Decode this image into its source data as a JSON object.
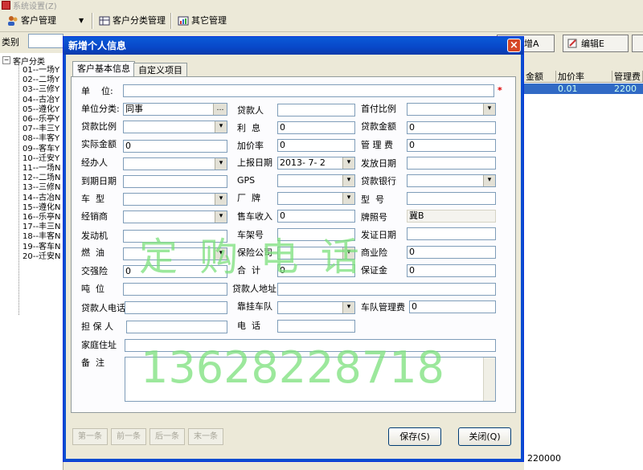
{
  "app": {
    "title": "系统设置(Z)",
    "toolbar": {
      "customer_mgmt": "客户管理",
      "customer_category_mgmt": "客户分类管理",
      "other_mgmt": "其它管理"
    },
    "filter_label": "类别",
    "right_buttons": {
      "add": "新增A",
      "edit": "编辑E"
    },
    "grid_headers": [
      "金额",
      "加价率",
      "管理费"
    ],
    "selected_row": {
      "markup": "0.01",
      "fee": "2200"
    },
    "footer_total": "220000"
  },
  "tree": {
    "root": "客户分类",
    "items": [
      "01--一场Y",
      "02--二场Y",
      "03--三修Y",
      "04--古冶Y",
      "05--遵化Y",
      "06--乐亭Y",
      "07--丰三Y",
      "08--丰客Y",
      "09--客车Y",
      "10--迁安Y",
      "11--一场N",
      "12--二场N",
      "13--三修N",
      "14--古冶N",
      "15--遵化N",
      "16--乐亭N",
      "17--丰三N",
      "18--丰客N",
      "19--客车N",
      "20--迁安N"
    ]
  },
  "dialog": {
    "title": "新增个人信息",
    "tabs": [
      "客户基本信息",
      "自定义项目"
    ],
    "fields": {
      "unit_label": "单    位:",
      "unit_category_label": "单位分类:",
      "unit_category_value": "同事",
      "loan_person_label": "贷款人",
      "down_payment_ratio_label": "首付比例",
      "loan_ratio_label": "贷款比例",
      "interest_label": "利  息",
      "interest_value": "0",
      "loan_amount_label": "贷款金额",
      "loan_amount_value": "0",
      "actual_amount_label": "实际金额",
      "actual_amount_value": "0",
      "markup_rate_label": "加价率",
      "markup_rate_value": "0",
      "mgmt_fee_label": "管 理 费",
      "mgmt_fee_value": "0",
      "handler_label": "经办人",
      "report_date_label": "上报日期",
      "report_date_value": "2013- 7- 2",
      "issue_date_label": "发放日期",
      "due_date_label": "到期日期",
      "gps_label": "GPS",
      "loan_bank_label": "贷款银行",
      "car_type_label": "车  型",
      "brand_label": "厂  牌",
      "model_label": "型  号",
      "dealer_label": "经销商",
      "car_sale_income_label": "售车收入",
      "car_sale_income_value": "0",
      "plate_no_label": "牌照号",
      "plate_no_value": "冀B",
      "engine_label": "发动机",
      "frame_no_label": "车架号",
      "cert_date_label": "发证日期",
      "fuel_label": "燃  油",
      "insurance_co_label": "保险公司",
      "commercial_ins_label": "商业险",
      "commercial_ins_value": "0",
      "compulsory_ins_label": "交强险",
      "compulsory_ins_value": "0",
      "total_label": "合  计",
      "total_value": "0",
      "deposit_label": "保证金",
      "deposit_value": "0",
      "tonnage_label": "吨  位",
      "loan_person_addr_label": "贷款人地址",
      "loan_person_phone_label": "贷款人电话",
      "fleet_label": "靠挂车队",
      "fleet_mgmt_fee_label": "车队管理费",
      "fleet_mgmt_fee_value": "0",
      "guarantor_label": "担 保 人",
      "phone_label": "电  话",
      "home_addr_label": "家庭住址",
      "remark_label": "备  注"
    },
    "watermark": {
      "text1": "定 购 电 话",
      "text2": "13628228718"
    },
    "nav": [
      "第一条",
      "前一条",
      "后一条",
      "末一条"
    ],
    "save": "保存(S)",
    "close": "关闭(Q)"
  },
  "colors": {
    "title_bar": "#0a5ad8",
    "watermark": "#7ce17c",
    "selection": "#316ac5"
  }
}
